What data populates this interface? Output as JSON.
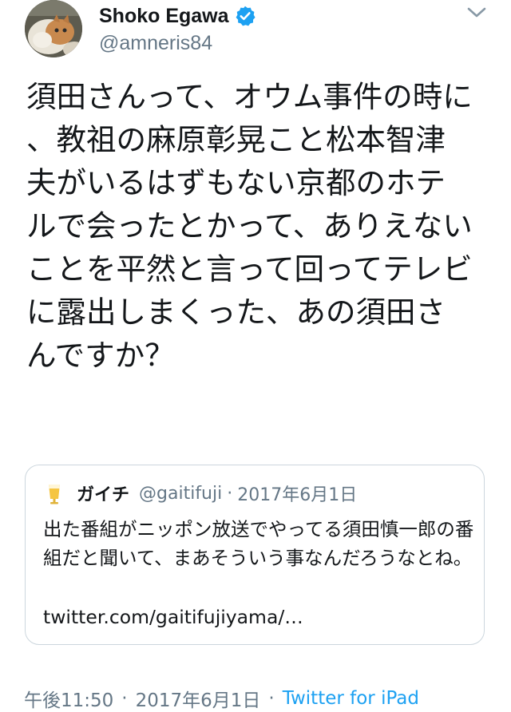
{
  "author": {
    "display_name": "Shoko Egawa",
    "handle": "@amneris84",
    "verified_icon": "verified-badge-icon",
    "avatar_icon": "cat-avatar"
  },
  "tweet": {
    "text": "須田さんって、オウム事件の時に、教祖の麻原彰晃こと松本智津夫がいるはずもない京都のホテルで会ったとかって、ありえないことを平然と言って回ってテレビに露出しまくった、あの須田さんですか？"
  },
  "quoted_tweet": {
    "name": "ガイチ",
    "handle": "@gaitifuji",
    "separator": "·",
    "date": "2017年6月1日",
    "text": "出た番組がニッポン放送でやってる須田慎一郎の番組だと聞いて、まあそういう事なんだろうなとね。",
    "link": "twitter.com/gaitifujiyama/…",
    "avatar_icon": "beer-glass-icon"
  },
  "meta": {
    "time": "午後11:50",
    "separator": "·",
    "date": "2017年6月1日",
    "source": "Twitter for iPad"
  },
  "colors": {
    "text": "#14171a",
    "secondary": "#657786",
    "link": "#1da1f2",
    "border": "#ccd6dd",
    "verified": "#1da1f2"
  }
}
